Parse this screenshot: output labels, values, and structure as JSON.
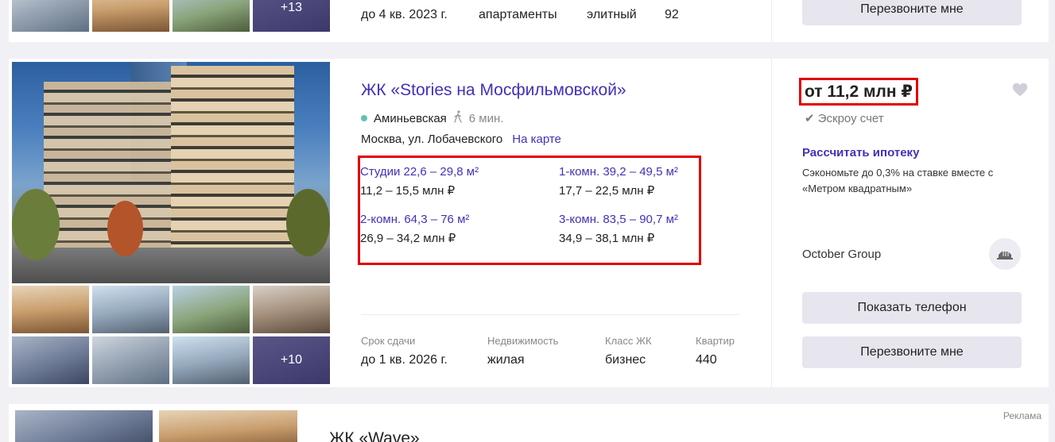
{
  "top_card": {
    "more_photos": "+13",
    "deadline": "до 4 кв. 2023 г.",
    "property": "апартаменты",
    "class": "элитный",
    "apartments": "92",
    "callback_button": "Перезвоните мне"
  },
  "complex": {
    "title": "ЖК «Stories на Мосфильмовской»",
    "metro": "Аминьевская",
    "walk_time": "6 мин.",
    "address": "Москва, ул. Лобачевского",
    "map_link": "На карте",
    "more_photos": "+10",
    "flats": [
      {
        "name": "Студии 22,6 – 29,8 м²",
        "price": "11,2 – 15,5 млн ₽"
      },
      {
        "name": "1-комн. 39,2 – 49,5 м²",
        "price": "17,7 – 22,5 млн ₽"
      },
      {
        "name": "2-комн. 64,3 – 76 м²",
        "price": "26,9 – 34,2 млн ₽"
      },
      {
        "name": "3-комн. 83,5 – 90,7 м²",
        "price": "34,9 – 38,1 млн ₽"
      }
    ],
    "props": [
      {
        "label": "Срок сдачи",
        "value": "до 1 кв. 2026 г."
      },
      {
        "label": "Недвижимость",
        "value": "жилая"
      },
      {
        "label": "Класс ЖК",
        "value": "бизнес"
      },
      {
        "label": "Квартир",
        "value": "440"
      }
    ],
    "price_from": "от 11,2 млн ₽",
    "escrow": "Эскроу счет",
    "mortgage_link": "Рассчитать ипотеку",
    "mortgage_note": "Сэкономьте до 0,3% на ставке вместе с «Метром квадратным»",
    "developer": "October Group",
    "show_phone_button": "Показать телефон",
    "callback_button": "Перезвоните мне"
  },
  "bottom_card": {
    "ad_label": "Реклама",
    "title": "ЖК «Wave»"
  },
  "colors": {
    "accent": "#4132b8",
    "highlight": "#e00000",
    "metro_line": "#5fc3b2",
    "button_bg": "#e7e6ef"
  }
}
